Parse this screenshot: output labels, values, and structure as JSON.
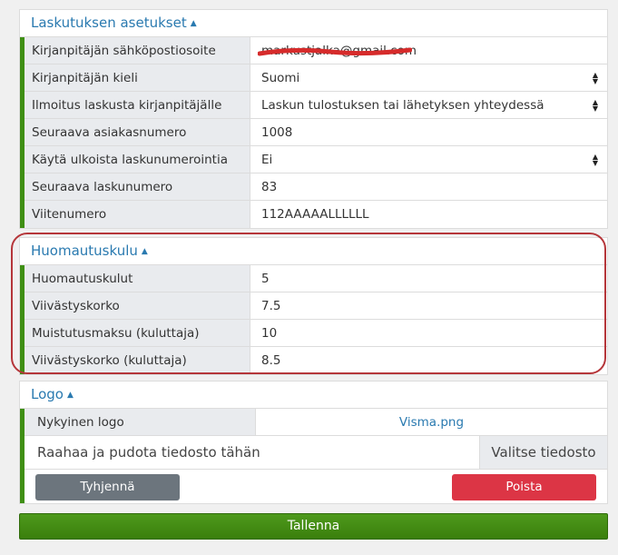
{
  "billing": {
    "title": "Laskutuksen asetukset",
    "rows": [
      {
        "label": "Kirjanpitäjän sähköpostiosoite",
        "value": "markustjalka@gmail.com"
      },
      {
        "label": "Kirjanpitäjän kieli",
        "value": "Suomi"
      },
      {
        "label": "Ilmoitus laskusta kirjanpitäjälle",
        "value": "Laskun tulostuksen tai lähetyksen yhteydessä"
      },
      {
        "label": "Seuraava asiakasnumero",
        "value": "1008"
      },
      {
        "label": "Käytä ulkoista laskunumerointia",
        "value": "Ei"
      },
      {
        "label": "Seuraava laskunumero",
        "value": "83"
      },
      {
        "label": "Viitenumero",
        "value": "112AAAAALLLLLL"
      }
    ]
  },
  "reminder": {
    "title": "Huomautuskulu",
    "rows": [
      {
        "label": "Huomautuskulut",
        "value": "5"
      },
      {
        "label": "Viivästyskorko",
        "value": "7.5"
      },
      {
        "label": "Muistutusmaksu (kuluttaja)",
        "value": "10"
      },
      {
        "label": "Viivästyskorko (kuluttaja)",
        "value": "8.5"
      }
    ]
  },
  "logo": {
    "title": "Logo",
    "current_label": "Nykyinen logo",
    "current_file": "Visma.png",
    "dropzone_text": "Raahaa ja pudota tiedosto tähän",
    "browse_label": "Valitse tiedosto",
    "clear_label": "Tyhjennä",
    "delete_label": "Poista"
  },
  "save_label": "Tallenna",
  "colors": {
    "accent": "#2a7ab0",
    "green": "#3f8f14",
    "danger": "#dc3545",
    "highlight": "#b5363a"
  }
}
